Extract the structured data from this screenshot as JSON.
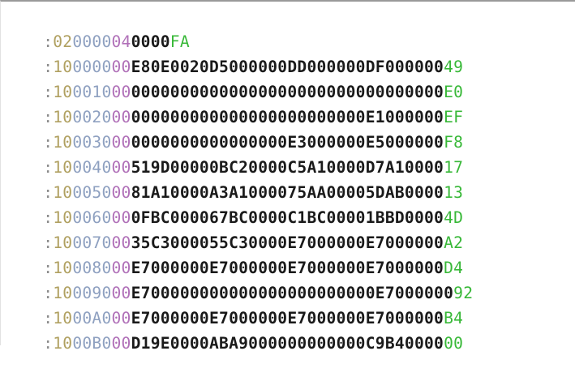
{
  "colors": {
    "colon": "#8a8a8a",
    "length": "#b0a060",
    "address": "#8ea0c0",
    "record_type": "#b070b8",
    "data": "#1a1a1a",
    "checksum": "#38b838"
  },
  "records": [
    {
      "colon": ":",
      "length": "02",
      "address": "0000",
      "type": "04",
      "data": "0000",
      "checksum": "FA"
    },
    {
      "colon": ":",
      "length": "10",
      "address": "0000",
      "type": "00",
      "data": "E80E0020D5000000DD000000DF000000",
      "checksum": "49"
    },
    {
      "colon": ":",
      "length": "10",
      "address": "0010",
      "type": "00",
      "data": "00000000000000000000000000000000",
      "checksum": "E0"
    },
    {
      "colon": ":",
      "length": "10",
      "address": "0020",
      "type": "00",
      "data": "000000000000000000000000E1000000",
      "checksum": "EF"
    },
    {
      "colon": ":",
      "length": "10",
      "address": "0030",
      "type": "00",
      "data": "0000000000000000E3000000E5000000",
      "checksum": "F8"
    },
    {
      "colon": ":",
      "length": "10",
      "address": "0040",
      "type": "00",
      "data": "519D00000BC20000C5A10000D7A10000",
      "checksum": "17"
    },
    {
      "colon": ":",
      "length": "10",
      "address": "0050",
      "type": "00",
      "data": "81A10000A3A1000075AA00005DAB0000",
      "checksum": "13"
    },
    {
      "colon": ":",
      "length": "10",
      "address": "0060",
      "type": "00",
      "data": "0FBC000067BC0000C1BC00001BBD0000",
      "checksum": "4D"
    },
    {
      "colon": ":",
      "length": "10",
      "address": "0070",
      "type": "00",
      "data": "35C3000055C30000E7000000E7000000",
      "checksum": "A2"
    },
    {
      "colon": ":",
      "length": "10",
      "address": "0080",
      "type": "00",
      "data": "E7000000E7000000E7000000E7000000",
      "checksum": "D4"
    },
    {
      "colon": ":",
      "length": "10",
      "address": "0090",
      "type": "00",
      "data": "E700000000000000000000000E7000000",
      "checksum": "92"
    },
    {
      "colon": ":",
      "length": "10",
      "address": "00A0",
      "type": "00",
      "data": "E7000000E7000000E7000000E7000000",
      "checksum": "B4"
    },
    {
      "colon": ":",
      "length": "10",
      "address": "00B0",
      "type": "00",
      "data": "D19E0000ABA9000000000000C9B40000",
      "checksum": "00"
    }
  ]
}
